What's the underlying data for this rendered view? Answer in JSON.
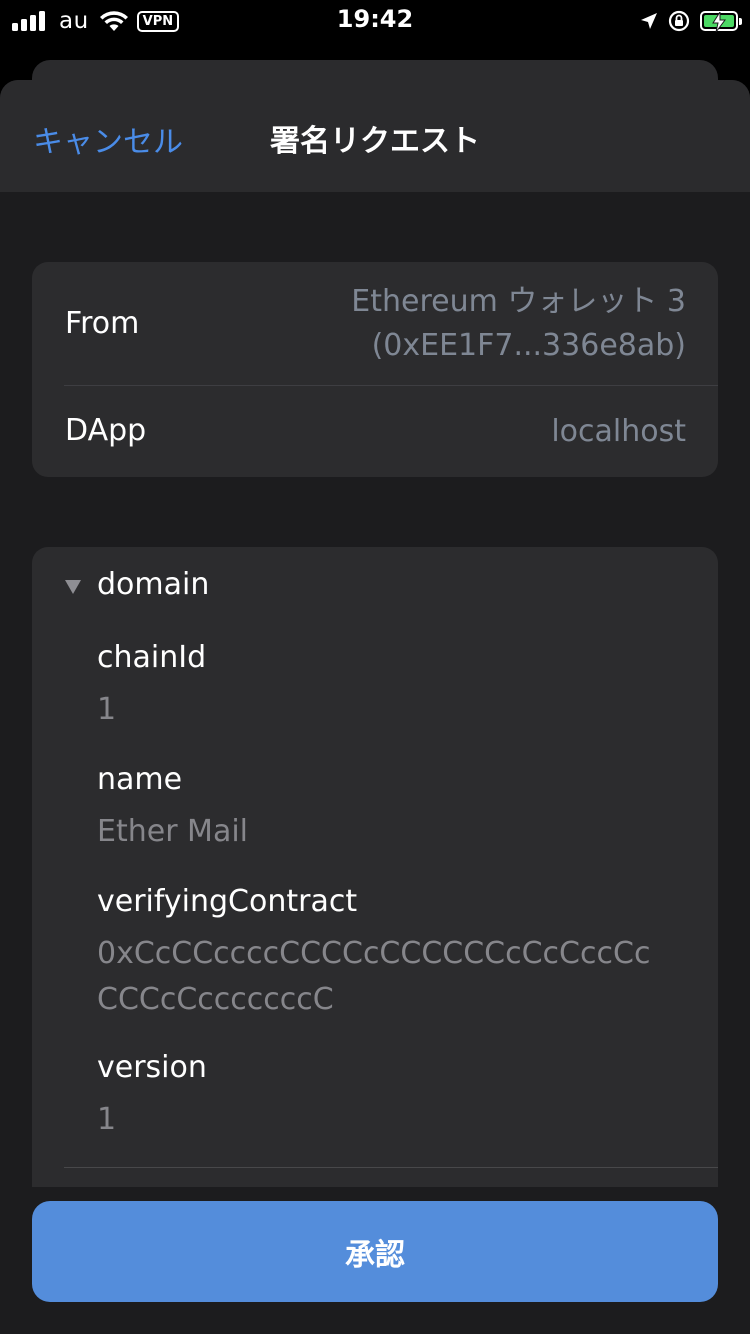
{
  "status_bar": {
    "carrier": "au",
    "vpn": "VPN",
    "time": "19:42",
    "icons": [
      "signal-icon",
      "wifi-icon",
      "location-icon",
      "orientation-lock-icon",
      "battery-charging-icon"
    ],
    "battery_color": "#4cd964"
  },
  "nav": {
    "cancel_label": "キャンセル",
    "title": "署名リクエスト"
  },
  "info": {
    "from_label": "From",
    "from_wallet": "Ethereum ウォレット 3",
    "from_address": "(0xEE1F7...336e8ab)",
    "dapp_label": "DApp",
    "dapp_value": "localhost"
  },
  "domain": {
    "label": "domain",
    "fields": [
      {
        "key": "chainId",
        "value": "1"
      },
      {
        "key": "name",
        "value": "Ether Mail"
      },
      {
        "key": "verifyingContract",
        "value": "0xCcCCccccCCCCcCCCCCCcCcCccCcCCCcCcccccccC"
      },
      {
        "key": "version",
        "value": "1"
      }
    ]
  },
  "approve_label": "承認",
  "colors": {
    "accent": "#4a8ce8",
    "approve_button": "#548ddb",
    "secondary_text": "#7f8794"
  }
}
